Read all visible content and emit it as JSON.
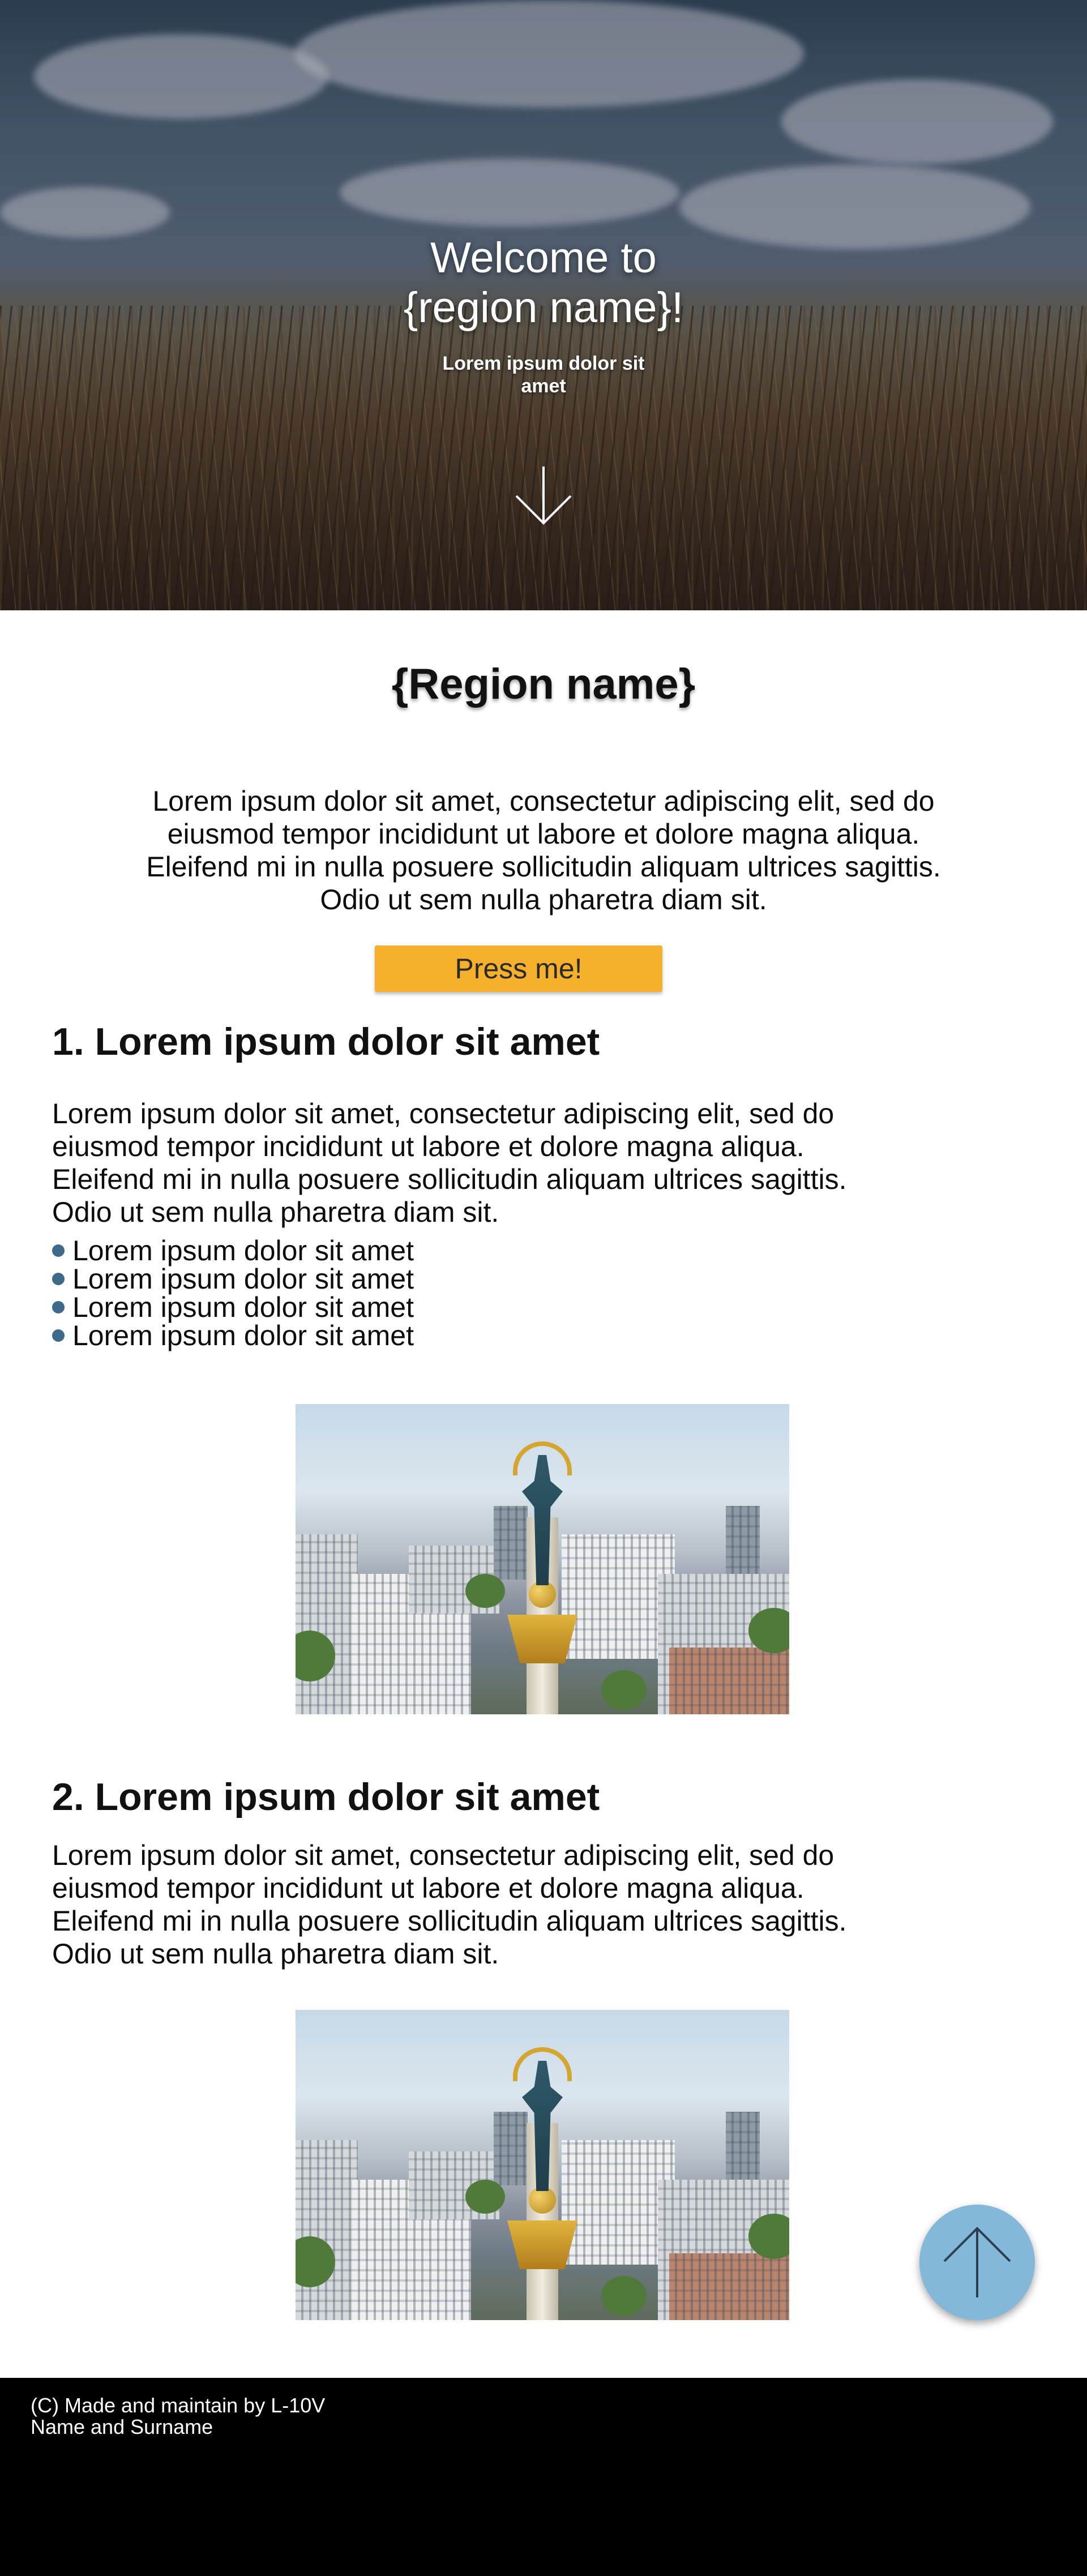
{
  "hero": {
    "title_line1": "Welcome to",
    "title_line2": "{region name}!",
    "subtitle_line1": "Lorem ipsum dolor sit",
    "subtitle_line2": "amet",
    "scroll_icon": "arrow-down-icon"
  },
  "region": {
    "title": "{Region name}",
    "intro_line1": "Lorem ipsum dolor sit amet, consectetur adipiscing elit, sed do",
    "intro_line2": "eiusmod tempor incididunt ut labore et dolore magna aliqua.",
    "intro_line3": "Eleifend mi in nulla posuere sollicitudin aliquam ultrices sagittis.",
    "intro_line4": "Odio ut sem nulla pharetra diam sit.",
    "button_label": "Press me!",
    "button_color": "#f6b02b"
  },
  "section1": {
    "heading": "1. Lorem ipsum dolor sit amet",
    "text_line1": "Lorem ipsum dolor sit amet, consectetur adipiscing elit, sed do",
    "text_line2": "eiusmod tempor incididunt ut labore et dolore magna aliqua.",
    "text_line3": "Eleifend mi in nulla posuere sollicitudin aliquam ultrices sagittis.",
    "text_line4": "Odio ut sem nulla pharetra diam sit.",
    "bullets": [
      "Lorem ipsum dolor sit amet",
      "Lorem ipsum dolor sit amet",
      "Lorem ipsum dolor sit amet",
      "Lorem ipsum dolor sit amet"
    ],
    "image_icon": "independence-monument-photo"
  },
  "section2": {
    "heading": "2. Lorem ipsum dolor sit amet",
    "text_line1": "Lorem ipsum dolor sit amet, consectetur adipiscing elit, sed do",
    "text_line2": "eiusmod tempor incididunt ut labore et dolore magna aliqua.",
    "text_line3": "Eleifend mi in nulla posuere sollicitudin aliquam ultrices sagittis.",
    "text_line4": "Odio ut sem nulla pharetra diam sit.",
    "image_icon": "independence-monument-photo"
  },
  "scroll_top": {
    "icon": "arrow-up-icon",
    "color": "#84b8d8"
  },
  "footer": {
    "line1": "(C) Made and maintain by L-10V",
    "line2": "Name and Surname"
  }
}
